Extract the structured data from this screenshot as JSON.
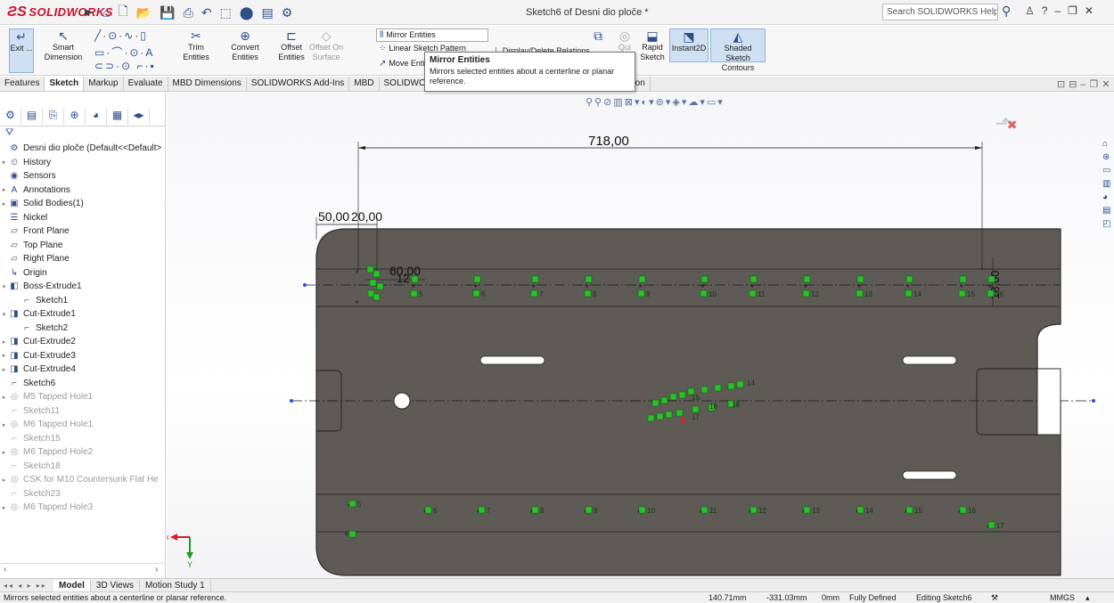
{
  "titlebar": {
    "logo": "SOLIDWORKS",
    "document_title": "Sketch6 of Desni dio ploče *",
    "search_placeholder": "Search SOLIDWORKS Help"
  },
  "ribbon": {
    "exit_label": "Exit ...",
    "smart_dimension": "Smart Dimension",
    "trim_entities": "Trim Entities",
    "convert_entities": "Convert Entities",
    "offset_entities_line1": "Offset",
    "offset_entities_line2": "Entities",
    "offset_on_surface_line1": "Offset On",
    "offset_on_surface_line2": "Surface",
    "mirror_entities": "Mirror Entities",
    "linear_sketch_pattern": "Linear Sketch Pattern",
    "move_entities": "Move Entities",
    "display_delete_relations": "Display/Delete Relations",
    "repair_sketch": "Qui",
    "rapid_sketch_line1": "Rapid",
    "rapid_sketch_line2": "Sketch",
    "instant2d": "Instant2D",
    "shaded_contours_line1": "Shaded Sketch",
    "shaded_contours_line2": "Contours"
  },
  "tooltip": {
    "title": "Mirror Entities",
    "description": "Mirrors selected entities about a centerline or planar reference."
  },
  "tabs": [
    "Features",
    "Sketch",
    "Markup",
    "Evaluate",
    "MBD Dimensions",
    "SOLIDWORKS Add-Ins",
    "MBD",
    "SOLIDWO",
    "",
    "S Inspection"
  ],
  "active_tab": "Sketch",
  "tree": [
    {
      "label": "Desni dio ploče  (Default<<Default>",
      "icon": "part-icon",
      "exp": "",
      "indent": 0
    },
    {
      "label": "History",
      "icon": "history-icon",
      "exp": "▸",
      "indent": 0
    },
    {
      "label": "Sensors",
      "icon": "sensors-icon",
      "exp": "",
      "indent": 0
    },
    {
      "label": "Annotations",
      "icon": "annotations-icon",
      "exp": "▸",
      "indent": 0
    },
    {
      "label": "Solid Bodies(1)",
      "icon": "solid-bodies-icon",
      "exp": "▸",
      "indent": 0
    },
    {
      "label": "Nickel",
      "icon": "material-icon",
      "exp": "",
      "indent": 0
    },
    {
      "label": "Front Plane",
      "icon": "plane-icon",
      "exp": "",
      "indent": 0
    },
    {
      "label": "Top Plane",
      "icon": "plane-icon",
      "exp": "",
      "indent": 0
    },
    {
      "label": "Right Plane",
      "icon": "plane-icon",
      "exp": "",
      "indent": 0
    },
    {
      "label": "Origin",
      "icon": "origin-icon",
      "exp": "",
      "indent": 0
    },
    {
      "label": "Boss-Extrude1",
      "icon": "boss-extrude-icon",
      "exp": "▾",
      "indent": 0
    },
    {
      "label": "Sketch1",
      "icon": "sketch-icon",
      "exp": "",
      "indent": 1
    },
    {
      "label": "Cut-Extrude1",
      "icon": "cut-extrude-icon",
      "exp": "▾",
      "indent": 0
    },
    {
      "label": "Sketch2",
      "icon": "sketch-icon",
      "exp": "",
      "indent": 1
    },
    {
      "label": "Cut-Extrude2",
      "icon": "cut-extrude-icon",
      "exp": "▸",
      "indent": 0
    },
    {
      "label": "Cut-Extrude3",
      "icon": "cut-extrude-icon",
      "exp": "▸",
      "indent": 0
    },
    {
      "label": "Cut-Extrude4",
      "icon": "cut-extrude-icon",
      "exp": "▸",
      "indent": 0
    },
    {
      "label": "Sketch6",
      "icon": "sketch-icon",
      "exp": "",
      "indent": 0
    },
    {
      "label": "M5 Tapped Hole1",
      "icon": "hole-icon",
      "exp": "▸",
      "indent": 0,
      "grey": true
    },
    {
      "label": "Sketch11",
      "icon": "sketch-icon",
      "exp": "",
      "indent": 0,
      "grey": true
    },
    {
      "label": "M6 Tapped Hole1",
      "icon": "hole-icon",
      "exp": "▸",
      "indent": 0,
      "grey": true
    },
    {
      "label": "Sketch15",
      "icon": "sketch-icon",
      "exp": "",
      "indent": 0,
      "grey": true
    },
    {
      "label": "M6 Tapped Hole2",
      "icon": "hole-icon",
      "exp": "▸",
      "indent": 0,
      "grey": true
    },
    {
      "label": "Sketch18",
      "icon": "sketch-icon",
      "exp": "",
      "indent": 0,
      "grey": true
    },
    {
      "label": "CSK for M10 Countersunk Flat He",
      "icon": "hole-icon",
      "exp": "▸",
      "indent": 0,
      "grey": true
    },
    {
      "label": "Sketch23",
      "icon": "sketch-icon",
      "exp": "",
      "indent": 0,
      "grey": true
    },
    {
      "label": "M6 Tapped Hole3",
      "icon": "hole-icon",
      "exp": "▸",
      "indent": 0,
      "grey": true
    }
  ],
  "sketch": {
    "dim_total": "718,00",
    "dim_left_a": "50,00",
    "dim_left_b": "20,00",
    "dim_inner_a": "60,00",
    "dim_inner_b": "12",
    "dim_vertical": "18,00",
    "top_row_relations": [
      "5",
      "6",
      "7",
      "8",
      "9",
      "10",
      "11",
      "12",
      "13",
      "14",
      "15",
      "16"
    ],
    "center_relations": [
      "14",
      "15",
      "16",
      "17",
      "18"
    ],
    "bottom_row_relations": [
      "5",
      "6",
      "7",
      "8",
      "9",
      "10",
      "11",
      "12",
      "13",
      "14",
      "15",
      "16",
      "17"
    ],
    "body_color": "#5e5a55",
    "relation_color": "#29c229",
    "axis_x_color": "#d42020",
    "axis_y_color": "#1f9d1f"
  },
  "axis_labels": {
    "x": "x",
    "y": "Y"
  },
  "bottom_tabs": [
    "Model",
    "3D Views",
    "Motion Study 1"
  ],
  "active_bottom_tab": "Model",
  "status": {
    "message": "Mirrors selected entities about a centerline or planar reference.",
    "x": "140.71mm",
    "y": "-331.03mm",
    "z": "0mm",
    "state": "Fully Defined",
    "editing": "Editing Sketch6",
    "units": "MMGS"
  }
}
